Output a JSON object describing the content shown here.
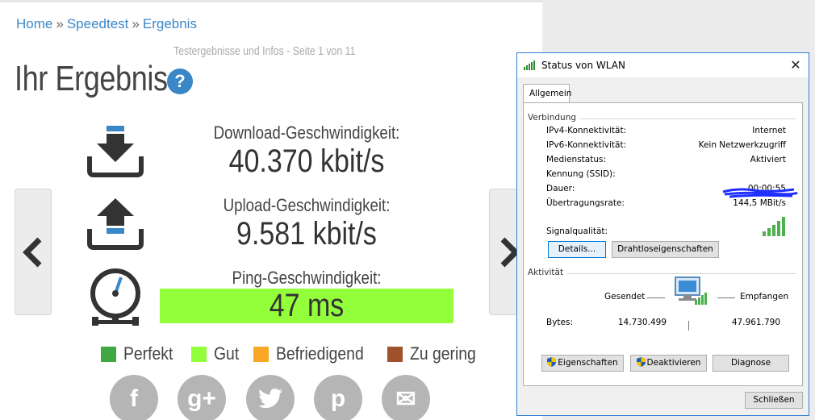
{
  "breadcrumb": {
    "home": "Home",
    "sep1": "»",
    "speedtest": "Speedtest",
    "sep2": "»",
    "result": "Ergebnis"
  },
  "page": {
    "subtitle": "Testergebnisse und Infos - Seite 1 von 11",
    "title": "Ihr Ergebnis",
    "help_glyph": "?"
  },
  "metrics": {
    "download": {
      "label": "Download-Geschwindigkeit:",
      "value": "40.370 kbit/s",
      "icon": "download-icon"
    },
    "upload": {
      "label": "Upload-Geschwindigkeit:",
      "value": "9.581 kbit/s",
      "icon": "upload-icon"
    },
    "ping": {
      "label": "Ping-Geschwindigkeit:",
      "value": "47 ms",
      "icon": "gauge-icon",
      "highlight_color": "#93ff3a"
    }
  },
  "legend": [
    {
      "label": "Perfekt",
      "color": "#3fa845"
    },
    {
      "label": "Gut",
      "color": "#93ff3a"
    },
    {
      "label": "Befriedigend",
      "color": "#f9a825"
    },
    {
      "label": "Zu gering",
      "color": "#a0522d"
    }
  ],
  "social": [
    {
      "name": "facebook-icon",
      "glyph": "f"
    },
    {
      "name": "google-plus-icon",
      "glyph": "g+"
    },
    {
      "name": "twitter-icon",
      "glyph": ""
    },
    {
      "name": "pinterest-icon",
      "glyph": "p"
    },
    {
      "name": "email-icon",
      "glyph": "✉"
    }
  ],
  "dialog": {
    "title": "Status von WLAN",
    "close_glyph": "✕",
    "tab": "Allgemein",
    "connection": {
      "heading": "Verbindung",
      "rows": [
        {
          "label": "IPv4-Konnektivität:",
          "value": "Internet"
        },
        {
          "label": "IPv6-Konnektivität:",
          "value": "Kein Netzwerkzugriff"
        },
        {
          "label": "Medienstatus:",
          "value": "Aktiviert"
        },
        {
          "label": "Kennung (SSID):",
          "value": ""
        },
        {
          "label": "Dauer:",
          "value": "00:00:55"
        },
        {
          "label": "Übertragungsrate:",
          "value": "144,5 MBit/s"
        }
      ],
      "signal_label": "Signalqualität:",
      "details_button": "Details...",
      "wireless_button": "Drahtloseigenschaften"
    },
    "activity": {
      "heading": "Aktivität",
      "sent_label": "Gesendet",
      "received_label": "Empfangen",
      "bytes_label": "Bytes:",
      "bytes_sent": "14.730.499",
      "bytes_received": "47.961.790"
    },
    "buttons": {
      "properties": "Eigenschaften",
      "disable": "Deaktivieren",
      "diagnose": "Diagnose",
      "close": "Schließen"
    }
  }
}
